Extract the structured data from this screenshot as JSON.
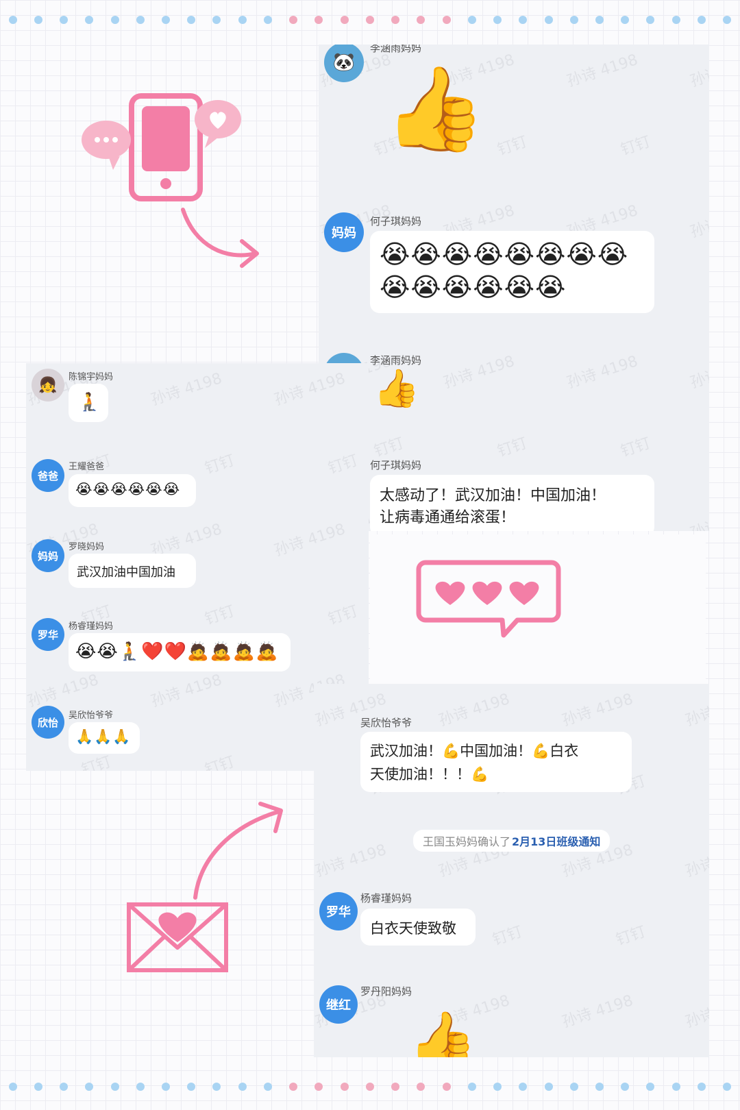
{
  "colors": {
    "avatar_blue": "#3b8fe6",
    "pink": "#f37ea6",
    "dot_blue": "#a9d4f3",
    "dot_pink": "#f1a9bd"
  },
  "watermark": {
    "a": "孙诗 4198",
    "b": "钉钉"
  },
  "right_panel": {
    "msg1": {
      "sender": "李涵雨妈妈",
      "avatar_icon": "panda-avatar",
      "content_icon": "thumbs-up-sticker"
    },
    "msg2": {
      "sender": "何子琪妈妈",
      "avatar_text": "妈妈",
      "emoji_row1": "😭😭😭😭😭😭😭😭",
      "emoji_row2": "😭😭😭😭😭😭"
    },
    "msg3": {
      "sender": "李涵雨妈妈",
      "content_icon": "thumbs-up-sticker-small"
    },
    "msg4": {
      "sender": "何子琪妈妈",
      "line1": "太感动了！武汉加油！中国加油！",
      "line2": "让病毒通通给滚蛋！"
    }
  },
  "left_panel": {
    "msg1": {
      "sender": "陈锦宇妈妈",
      "avatar_icon": "girl-photo-avatar",
      "emoji": "🧎"
    },
    "msg2": {
      "sender": "王耀爸爸",
      "avatar_text": "爸爸",
      "emoji": "😭😭😭😭😭😭"
    },
    "msg3": {
      "sender": "罗晓妈妈",
      "avatar_text": "妈妈",
      "text": "武汉加油中国加油"
    },
    "msg4": {
      "sender": "杨睿瑾妈妈",
      "avatar_text": "罗华",
      "emoji": "😭😭🧎❤️❤️🙇🙇🙇🙇"
    },
    "msg5": {
      "sender": "吴欣怡爷爷",
      "avatar_text": "欣怡",
      "emoji": "🙏🙏🙏"
    }
  },
  "bottom_panel": {
    "msg1": {
      "sender": "吴欣怡爷爷",
      "line1": "武汉加油！💪中国加油！💪白衣",
      "line2": "天使加油！！！💪"
    },
    "system": {
      "prefix": "王国玉妈妈确认了",
      "link": "2月13日班级通知"
    },
    "msg2": {
      "sender": "杨睿瑾妈妈",
      "avatar_text": "罗华",
      "text": "白衣天使致敬"
    },
    "msg3": {
      "sender": "罗丹阳妈妈",
      "avatar_text": "继红",
      "content_icon": "thumbs-up-sticker"
    }
  }
}
